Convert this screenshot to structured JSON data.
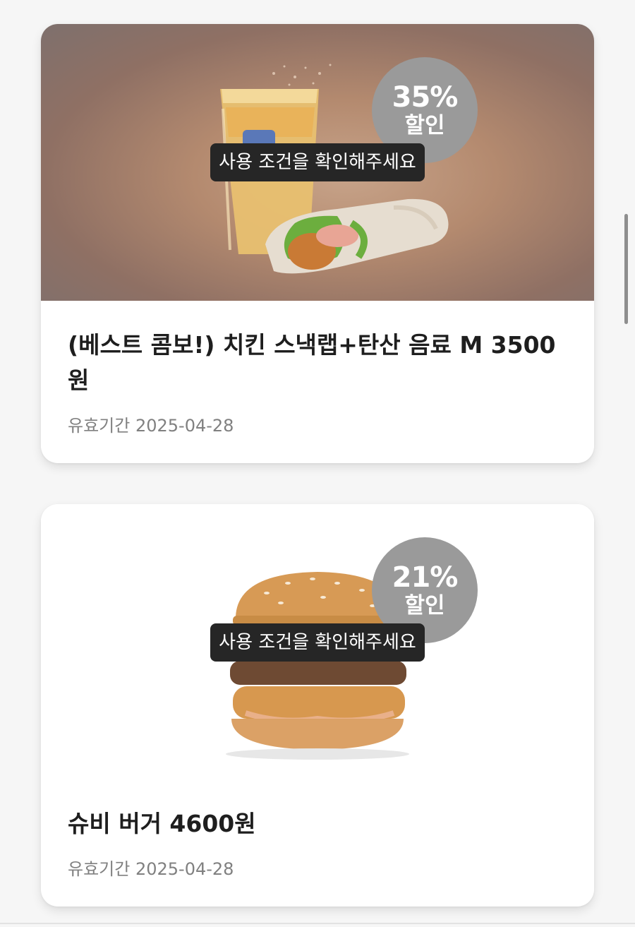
{
  "coupons": [
    {
      "product": "(베스트 콤보!) 치킨 스낵랩+탄산 음료 M 3500원",
      "discount_percent": "35%",
      "discount_label": "할인",
      "notice": "사용 조건을 확인해주세요",
      "validity_label": "유효기간",
      "validity_date": "2025-04-28",
      "image": "chicken-snack-wrap-and-iced-drink"
    },
    {
      "product": "슈비 버거 4600원",
      "discount_percent": "21%",
      "discount_label": "할인",
      "notice": "사용 조건을 확인해주세요",
      "validity_label": "유효기간",
      "validity_date": "2025-04-28",
      "image": "shrimp-beef-burger"
    }
  ],
  "colors": {
    "badge": "#9a9a9a",
    "tooltip": "#262626",
    "title": "#1e1e1e",
    "validity": "#808080"
  }
}
